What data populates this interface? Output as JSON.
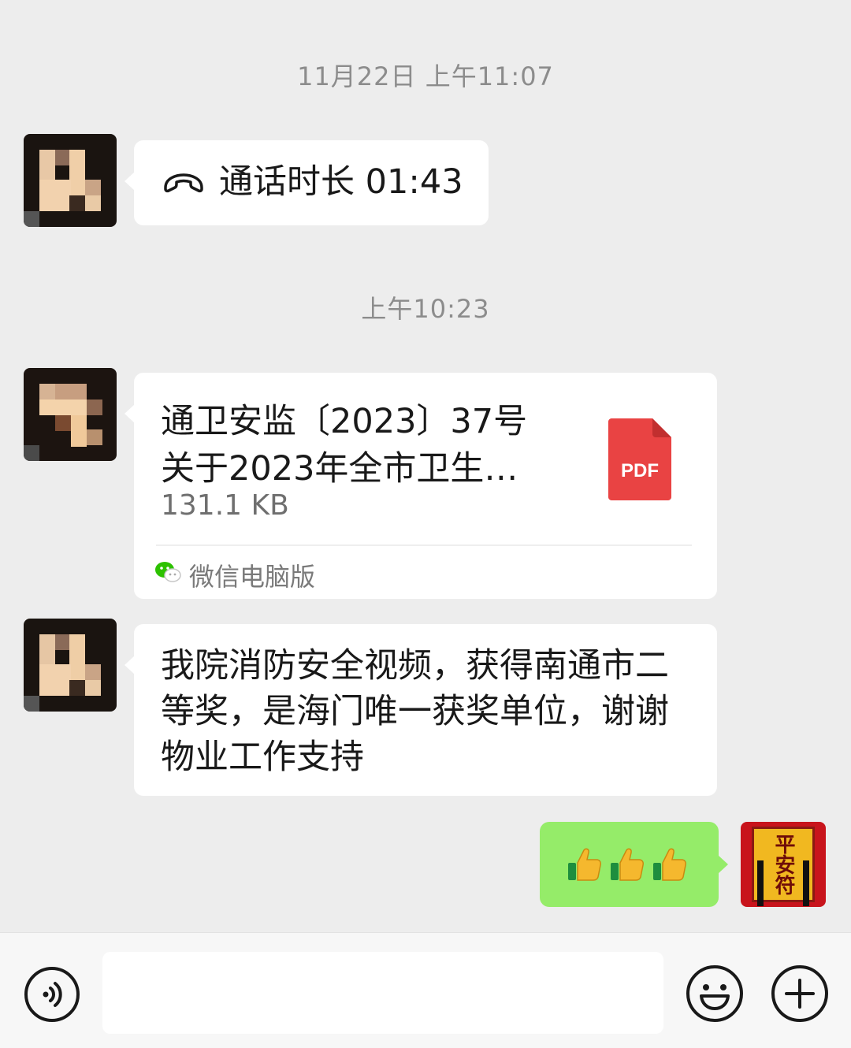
{
  "chat": {
    "timestamp_1": "11月22日 上午11:07",
    "call_message": {
      "text": "通话时长 01:43",
      "icon": "phone-hangup-icon"
    },
    "timestamp_2": "上午10:23",
    "file_message": {
      "name_line1": "通卫安监〔2023〕37号",
      "name_line2": "关于2023年全市卫生…",
      "size": "131.1 KB",
      "icon_label": "PDF",
      "source": "微信电脑版"
    },
    "text_message": {
      "text": "我院消防安全视频，获得南通市二等奖，是海门唯一获奖单位，谢谢物业工作支持"
    },
    "my_message": {
      "emojis": [
        "thumbs-up",
        "thumbs-up",
        "thumbs-up"
      ]
    },
    "my_avatar": {
      "label": "平安符"
    }
  },
  "colors": {
    "background": "#ededed",
    "incoming_bubble": "#ffffff",
    "outgoing_bubble": "#95ec69",
    "pdf_red": "#e94343"
  },
  "input_bar": {
    "buttons": [
      "voice-icon",
      "emoji-icon",
      "plus-icon"
    ]
  }
}
